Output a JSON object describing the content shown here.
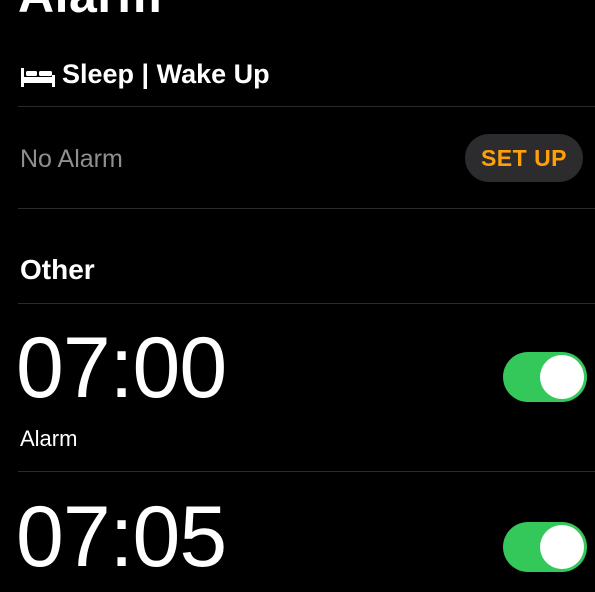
{
  "header": {
    "title": "Alarm"
  },
  "sleep": {
    "label": "Sleep | Wake Up",
    "icon": "bed-icon",
    "status": "No Alarm",
    "setup_label": "SET UP"
  },
  "other": {
    "header": "Other",
    "alarms": [
      {
        "time": "07:00",
        "label": "Alarm",
        "enabled": true
      },
      {
        "time": "07:05",
        "label": "",
        "enabled": true
      }
    ]
  },
  "colors": {
    "background": "#000000",
    "accent_orange": "#ff9f0a",
    "toggle_green": "#34c759",
    "secondary_text": "#8e8e93",
    "button_bg": "#2c2c2e"
  }
}
